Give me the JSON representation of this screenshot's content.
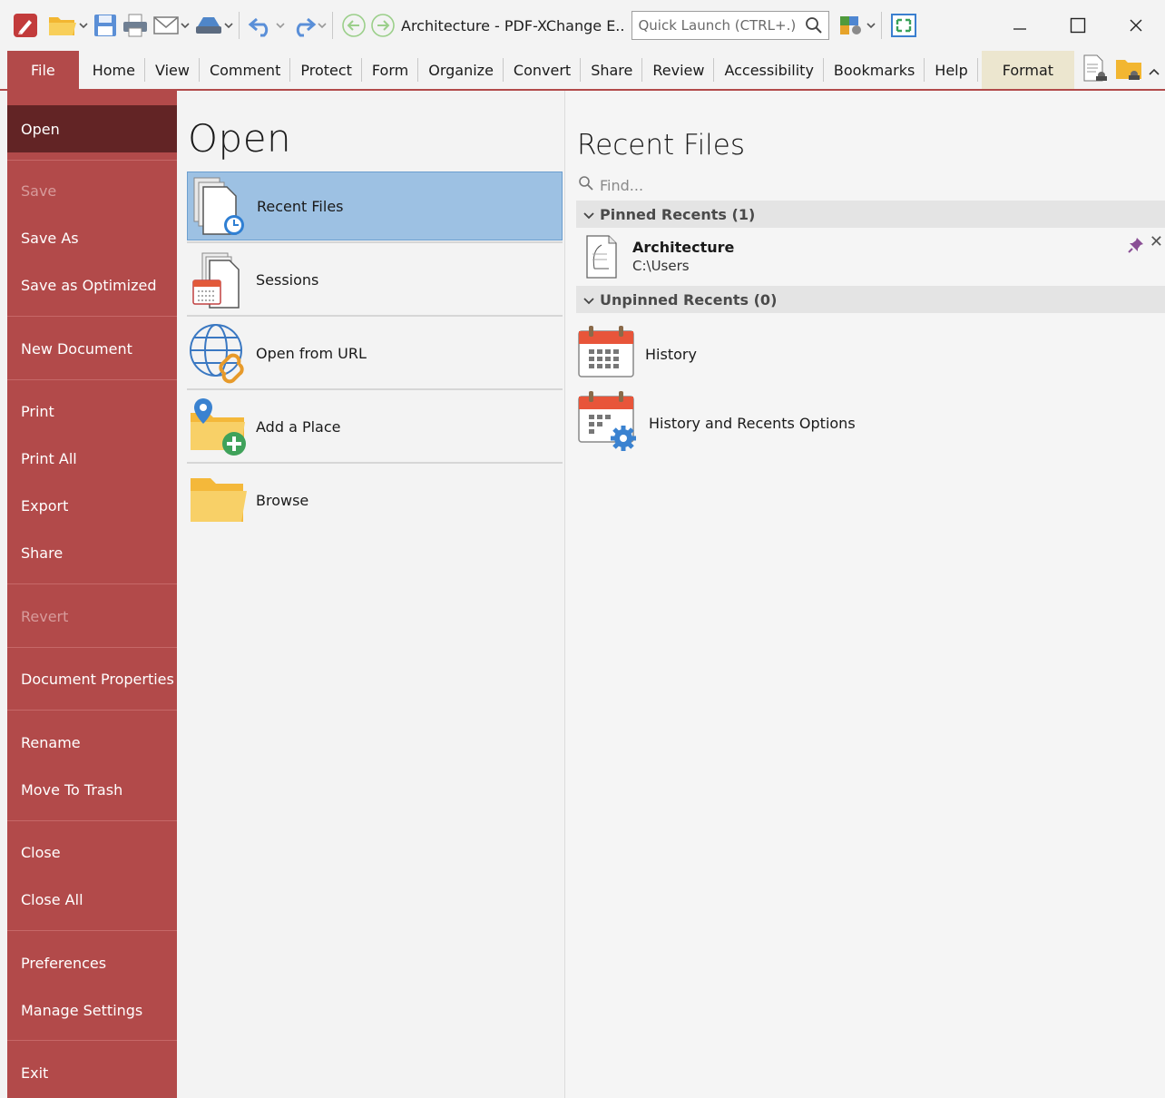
{
  "window": {
    "title": "Architecture - PDF-XChange E..",
    "quick_launch_placeholder": "Quick Launch (CTRL+.)"
  },
  "quick_access": [
    "app-logo-icon",
    "open-folder-icon",
    "save-icon",
    "print-icon",
    "email-icon",
    "scan-icon",
    "undo-icon",
    "redo-icon",
    "back-icon",
    "forward-icon"
  ],
  "ribbon": {
    "tabs": [
      "File",
      "Home",
      "View",
      "Comment",
      "Protect",
      "Form",
      "Organize",
      "Convert",
      "Share",
      "Review",
      "Accessibility",
      "Bookmarks",
      "Help",
      "Format"
    ],
    "active_tab": "File"
  },
  "sidebar": {
    "items": [
      {
        "label": "Open",
        "state": "active"
      },
      {
        "label": "Save",
        "state": "disabled"
      },
      {
        "label": "Save As",
        "state": "normal"
      },
      {
        "label": "Save as Optimized",
        "state": "normal"
      },
      {
        "label": "New Document",
        "state": "normal"
      },
      {
        "label": "Print",
        "state": "normal"
      },
      {
        "label": "Print All",
        "state": "normal"
      },
      {
        "label": "Export",
        "state": "normal"
      },
      {
        "label": "Share",
        "state": "normal"
      },
      {
        "label": "Revert",
        "state": "disabled"
      },
      {
        "label": "Document Properties",
        "state": "normal"
      },
      {
        "label": "Rename",
        "state": "normal"
      },
      {
        "label": "Move To Trash",
        "state": "normal"
      },
      {
        "label": "Close",
        "state": "normal"
      },
      {
        "label": "Close All",
        "state": "normal"
      },
      {
        "label": "Preferences",
        "state": "normal"
      },
      {
        "label": "Manage Settings",
        "state": "normal"
      },
      {
        "label": "Exit",
        "state": "normal"
      }
    ]
  },
  "open_panel": {
    "heading": "Open",
    "items": [
      {
        "label": "Recent Files",
        "icon": "recent-files-icon",
        "selected": true
      },
      {
        "label": "Sessions",
        "icon": "sessions-icon",
        "selected": false
      },
      {
        "label": "Open from URL",
        "icon": "globe-link-icon",
        "selected": false
      },
      {
        "label": "Add a Place",
        "icon": "add-place-icon",
        "selected": false
      },
      {
        "label": "Browse",
        "icon": "folder-icon",
        "selected": false
      }
    ]
  },
  "recent_panel": {
    "heading": "Recent Files",
    "find_placeholder": "Find...",
    "pinned_group": "Pinned Recents (1)",
    "unpinned_group": "Unpinned Recents (0)",
    "pinned_files": [
      {
        "name": "Architecture",
        "path": "C:\\Users"
      }
    ],
    "commands": [
      {
        "label": "History",
        "icon": "calendar-icon"
      },
      {
        "label": "History and Recents Options",
        "icon": "calendar-gear-icon"
      }
    ]
  },
  "colors": {
    "accent": "#b24a4a",
    "sidebar_active": "#622425",
    "selection": "#9dc1e3",
    "format_tab": "#ece6cf"
  }
}
